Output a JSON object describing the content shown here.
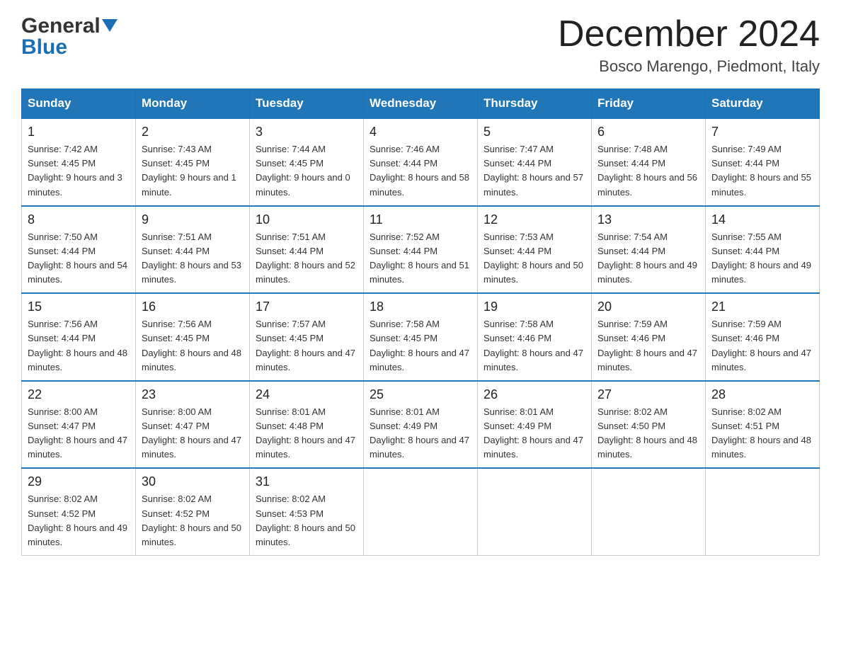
{
  "logo": {
    "general": "General",
    "blue": "Blue",
    "arrow": "▼"
  },
  "header": {
    "month": "December 2024",
    "location": "Bosco Marengo, Piedmont, Italy"
  },
  "weekdays": [
    "Sunday",
    "Monday",
    "Tuesday",
    "Wednesday",
    "Thursday",
    "Friday",
    "Saturday"
  ],
  "weeks": [
    [
      {
        "day": "1",
        "sunrise": "7:42 AM",
        "sunset": "4:45 PM",
        "daylight": "9 hours and 3 minutes."
      },
      {
        "day": "2",
        "sunrise": "7:43 AM",
        "sunset": "4:45 PM",
        "daylight": "9 hours and 1 minute."
      },
      {
        "day": "3",
        "sunrise": "7:44 AM",
        "sunset": "4:45 PM",
        "daylight": "9 hours and 0 minutes."
      },
      {
        "day": "4",
        "sunrise": "7:46 AM",
        "sunset": "4:44 PM",
        "daylight": "8 hours and 58 minutes."
      },
      {
        "day": "5",
        "sunrise": "7:47 AM",
        "sunset": "4:44 PM",
        "daylight": "8 hours and 57 minutes."
      },
      {
        "day": "6",
        "sunrise": "7:48 AM",
        "sunset": "4:44 PM",
        "daylight": "8 hours and 56 minutes."
      },
      {
        "day": "7",
        "sunrise": "7:49 AM",
        "sunset": "4:44 PM",
        "daylight": "8 hours and 55 minutes."
      }
    ],
    [
      {
        "day": "8",
        "sunrise": "7:50 AM",
        "sunset": "4:44 PM",
        "daylight": "8 hours and 54 minutes."
      },
      {
        "day": "9",
        "sunrise": "7:51 AM",
        "sunset": "4:44 PM",
        "daylight": "8 hours and 53 minutes."
      },
      {
        "day": "10",
        "sunrise": "7:51 AM",
        "sunset": "4:44 PM",
        "daylight": "8 hours and 52 minutes."
      },
      {
        "day": "11",
        "sunrise": "7:52 AM",
        "sunset": "4:44 PM",
        "daylight": "8 hours and 51 minutes."
      },
      {
        "day": "12",
        "sunrise": "7:53 AM",
        "sunset": "4:44 PM",
        "daylight": "8 hours and 50 minutes."
      },
      {
        "day": "13",
        "sunrise": "7:54 AM",
        "sunset": "4:44 PM",
        "daylight": "8 hours and 49 minutes."
      },
      {
        "day": "14",
        "sunrise": "7:55 AM",
        "sunset": "4:44 PM",
        "daylight": "8 hours and 49 minutes."
      }
    ],
    [
      {
        "day": "15",
        "sunrise": "7:56 AM",
        "sunset": "4:44 PM",
        "daylight": "8 hours and 48 minutes."
      },
      {
        "day": "16",
        "sunrise": "7:56 AM",
        "sunset": "4:45 PM",
        "daylight": "8 hours and 48 minutes."
      },
      {
        "day": "17",
        "sunrise": "7:57 AM",
        "sunset": "4:45 PM",
        "daylight": "8 hours and 47 minutes."
      },
      {
        "day": "18",
        "sunrise": "7:58 AM",
        "sunset": "4:45 PM",
        "daylight": "8 hours and 47 minutes."
      },
      {
        "day": "19",
        "sunrise": "7:58 AM",
        "sunset": "4:46 PM",
        "daylight": "8 hours and 47 minutes."
      },
      {
        "day": "20",
        "sunrise": "7:59 AM",
        "sunset": "4:46 PM",
        "daylight": "8 hours and 47 minutes."
      },
      {
        "day": "21",
        "sunrise": "7:59 AM",
        "sunset": "4:46 PM",
        "daylight": "8 hours and 47 minutes."
      }
    ],
    [
      {
        "day": "22",
        "sunrise": "8:00 AM",
        "sunset": "4:47 PM",
        "daylight": "8 hours and 47 minutes."
      },
      {
        "day": "23",
        "sunrise": "8:00 AM",
        "sunset": "4:47 PM",
        "daylight": "8 hours and 47 minutes."
      },
      {
        "day": "24",
        "sunrise": "8:01 AM",
        "sunset": "4:48 PM",
        "daylight": "8 hours and 47 minutes."
      },
      {
        "day": "25",
        "sunrise": "8:01 AM",
        "sunset": "4:49 PM",
        "daylight": "8 hours and 47 minutes."
      },
      {
        "day": "26",
        "sunrise": "8:01 AM",
        "sunset": "4:49 PM",
        "daylight": "8 hours and 47 minutes."
      },
      {
        "day": "27",
        "sunrise": "8:02 AM",
        "sunset": "4:50 PM",
        "daylight": "8 hours and 48 minutes."
      },
      {
        "day": "28",
        "sunrise": "8:02 AM",
        "sunset": "4:51 PM",
        "daylight": "8 hours and 48 minutes."
      }
    ],
    [
      {
        "day": "29",
        "sunrise": "8:02 AM",
        "sunset": "4:52 PM",
        "daylight": "8 hours and 49 minutes."
      },
      {
        "day": "30",
        "sunrise": "8:02 AM",
        "sunset": "4:52 PM",
        "daylight": "8 hours and 50 minutes."
      },
      {
        "day": "31",
        "sunrise": "8:02 AM",
        "sunset": "4:53 PM",
        "daylight": "8 hours and 50 minutes."
      },
      null,
      null,
      null,
      null
    ]
  ]
}
